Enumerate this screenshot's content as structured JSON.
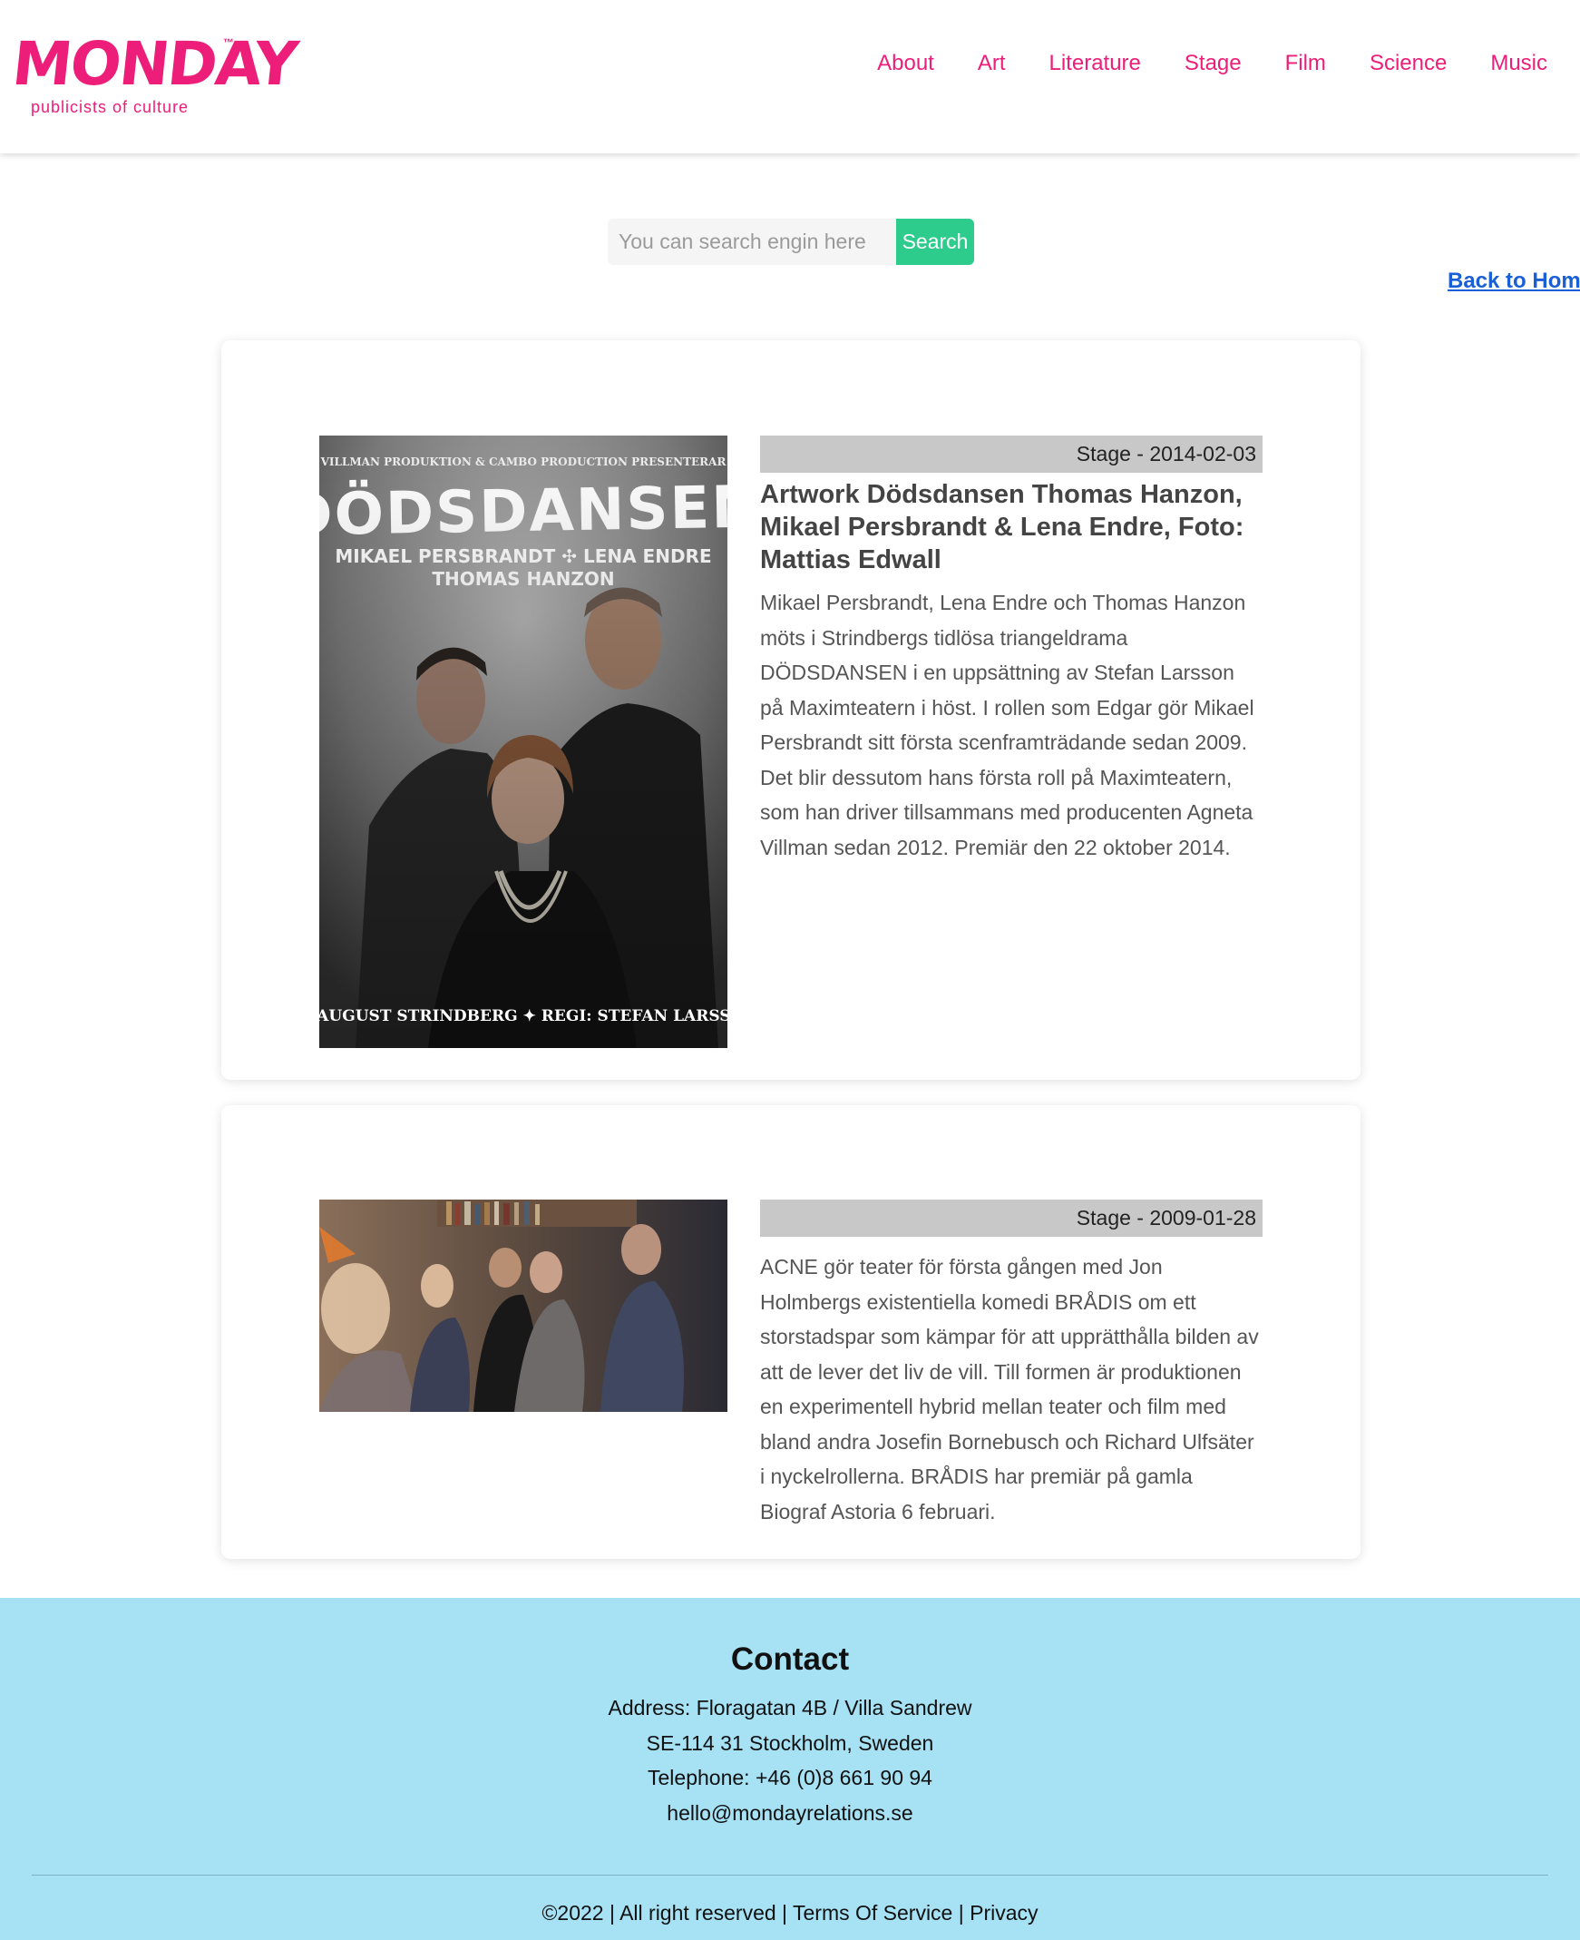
{
  "brand": {
    "name": "MONDAY",
    "tm": "™",
    "tagline": "publicists of culture",
    "color": "#ec1e79"
  },
  "nav": {
    "items": [
      {
        "label": "About"
      },
      {
        "label": "Art"
      },
      {
        "label": "Literature"
      },
      {
        "label": "Stage"
      },
      {
        "label": "Film"
      },
      {
        "label": "Science"
      },
      {
        "label": "Music"
      }
    ]
  },
  "search": {
    "placeholder": "You can search engin here",
    "value": "",
    "button_label": "Search"
  },
  "back_home": "Back to Home",
  "posts": [
    {
      "meta": "Stage - 2014-02-03",
      "title": "Artwork Dödsdansen Thomas Hanzon, Mikael Persbrandt & Lena Endre, Foto: Mattias Edwall",
      "text": "Mikael Persbrandt, Lena Endre och Thomas Hanzon möts i Strindbergs tidlösa triangeldrama DÖDSDANSEN i en uppsättning av Stefan Larsson på Maximteatern i höst. I rollen som Edgar gör Mikael Persbrandt sitt första scenframträdande sedan 2009. Det blir dessutom hans första roll på Maximteatern, som han driver tillsammans med producenten Agneta Villman sedan 2012.   Premiär den 22 oktober 2014.",
      "poster": {
        "presenter": "VILLMAN PRODUKTION & CAMBO PRODUCTION PRESENTERAR",
        "headline": "DÖDSDANSEN",
        "cast_line1": "MIKAEL PERSBRANDT ✣ LENA ENDRE",
        "cast_line2": "THOMAS HANZON",
        "credits": "AV AUGUST STRINDBERG ✦ REGI: STEFAN LARSSON"
      }
    },
    {
      "meta": "Stage - 2009-01-28",
      "title": "",
      "text": "ACNE gör teater för första gången med Jon Holmbergs existentiella komedi BRÅDIS om ett storstadspar som kämpar för att upprätthålla bilden av att de lever det liv de vill. Till formen är produktionen en experimentell hybrid mellan teater och film med bland andra Josefin Bornebusch och Richard Ulfsäter i nyckelrollerna. BRÅDIS har premiär på gamla Biograf Astoria 6 februari."
    }
  ],
  "footer": {
    "heading": "Contact",
    "address": "Address: Floragatan 4B / Villa Sandrew",
    "city": "SE-114 31 Stockholm, Sweden",
    "phone": "Telephone: +46 (0)8 661 90 94",
    "email": "hello@mondayrelations.se",
    "copyright": "©2022 | All right reserved | Terms Of Service | Privacy"
  },
  "colors": {
    "footer_bg": "#a6e1f4",
    "search_button": "#2ecc8c",
    "meta_bar": "#c8c8c8",
    "link": "#1a5fd6"
  }
}
